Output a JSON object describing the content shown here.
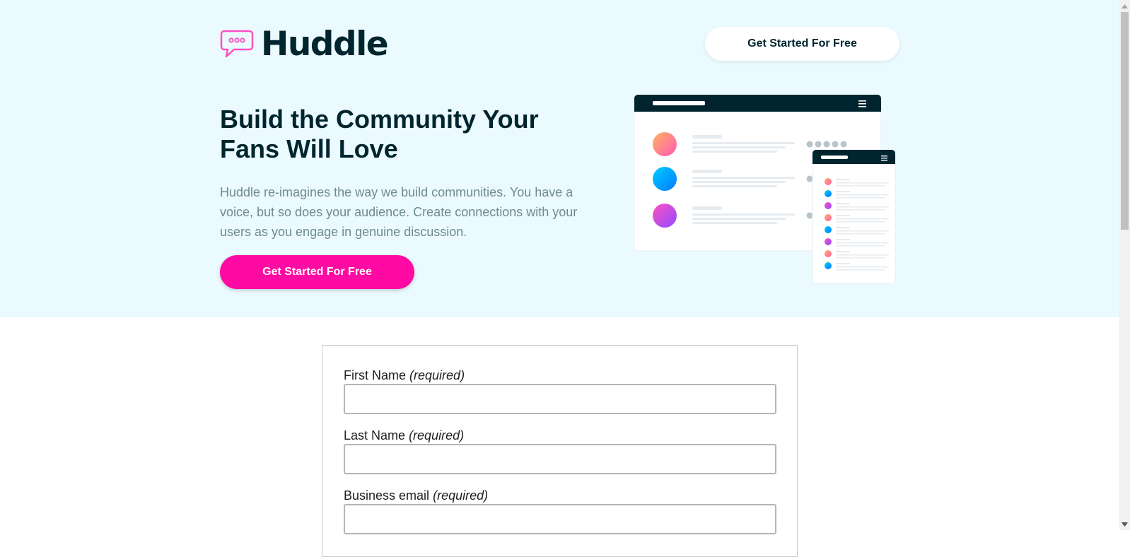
{
  "brand": {
    "name": "Huddle",
    "logo_icon": "speech-bubble-icon"
  },
  "header": {
    "cta_label": "Get Started For Free"
  },
  "hero": {
    "title": "Build the Community Your Fans Will Love",
    "description": "Huddle re-imagines the way we build communities. You have a voice, but so does your audience. Create connections with your users as you engage in genuine discussion.",
    "cta_label": "Get Started For Free"
  },
  "form": {
    "fields": [
      {
        "label": "First Name",
        "required_note": "(required)",
        "value": ""
      },
      {
        "label": "Last Name",
        "required_note": "(required)",
        "value": ""
      },
      {
        "label": "Business email",
        "required_note": "(required)",
        "value": ""
      }
    ]
  },
  "colors": {
    "hero_background": "#eafafe",
    "primary_dark": "#00252e",
    "accent_pink": "#ff0aa3",
    "text_muted": "#6f8a93"
  }
}
